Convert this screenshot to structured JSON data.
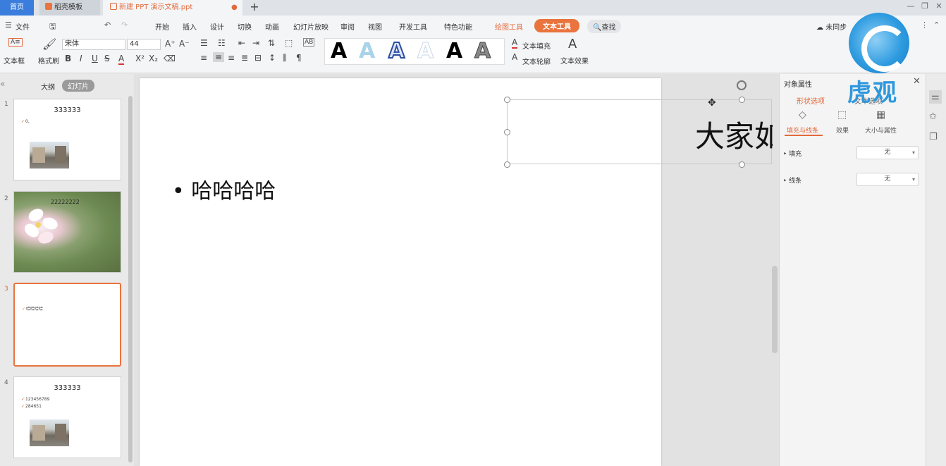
{
  "tabs": {
    "home": "首页",
    "template": "稻壳模板",
    "document": "新建 PPT 演示文稿.ppt",
    "add": "+"
  },
  "menubar": {
    "file": "文件",
    "items": [
      "开始",
      "插入",
      "设计",
      "切换",
      "动画",
      "幻灯片放映",
      "审阅",
      "视图",
      "开发工具",
      "特色功能"
    ],
    "draw_tools": "绘图工具",
    "text_tools": "文本工具",
    "search": "查找",
    "sync": "未同步"
  },
  "ribbon": {
    "textbox": "文本框",
    "format_painter": "格式刷",
    "font_name": "宋体",
    "font_size": "44",
    "text_fill": "文本填充",
    "text_outline": "文本轮廓",
    "text_effect": "文本效果",
    "art_letter": "A"
  },
  "left_panel": {
    "outline_tab": "大纲",
    "slides_tab": "幻灯片",
    "slides": [
      {
        "num": "1",
        "title": "333333",
        "lines": [
          "0,"
        ]
      },
      {
        "num": "2",
        "caption": "22222222"
      },
      {
        "num": "3",
        "lines": [
          "哈哈哈哈"
        ]
      },
      {
        "num": "4",
        "title": "333333",
        "lines": [
          "123456789",
          "284651"
        ]
      }
    ]
  },
  "slide": {
    "bullet_text": "哈哈哈哈",
    "big_text": "大家如"
  },
  "props_panel": {
    "title": "对象属性",
    "shape_options": "形状选项",
    "text_options": "文本选项",
    "subtabs": [
      "填充与线条",
      "效果",
      "大小与属性"
    ],
    "fill_label": "填充",
    "fill_value": "无",
    "line_label": "线条",
    "line_value": "无"
  },
  "watermark": {
    "text": "虎观"
  }
}
